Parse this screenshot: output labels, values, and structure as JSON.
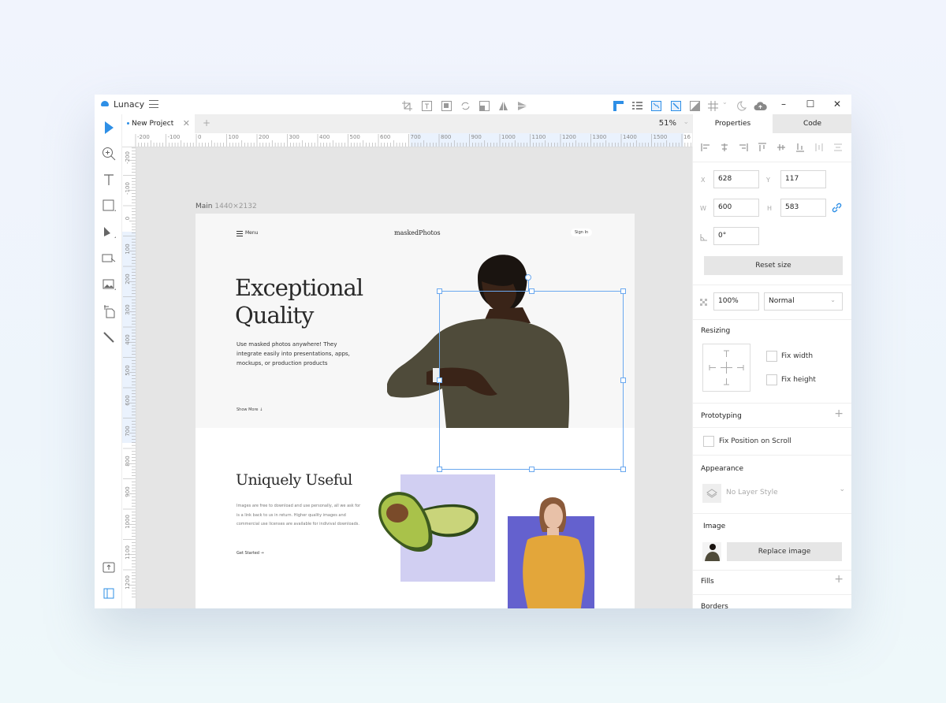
{
  "app": {
    "name": "Lunacy"
  },
  "tabs": [
    {
      "label": "New Project",
      "modified": true
    }
  ],
  "zoom": {
    "level": "51%"
  },
  "rulers": {
    "horizontal": [
      "-200",
      "-100",
      "0",
      "100",
      "200",
      "300",
      "400",
      "500",
      "600",
      "700",
      "800",
      "900",
      "1000",
      "1100",
      "1200",
      "1300",
      "1400",
      "1500",
      "16"
    ],
    "vertical": [
      "-200",
      "-100",
      "0",
      "100",
      "200",
      "300",
      "400",
      "500",
      "600",
      "700",
      "800",
      "900",
      "1000",
      "1100",
      "1200"
    ]
  },
  "artboard": {
    "name": "Main",
    "size": "1440×2132"
  },
  "design": {
    "nav": {
      "menu": "Menu",
      "brand": "maskedPhotos",
      "signin": "Sign In"
    },
    "hero": {
      "title_line1": "Exceptional",
      "title_line2": "Quality",
      "body": "Use masked photos anywhere! They integrate easily into presentations, apps, mockups, or production products",
      "cta": "Show More ↓"
    },
    "section2": {
      "title": "Uniquely Useful",
      "body": "Images are free to download and use personally, all we ask for is a link back to us in return. Higher quality images and commercial use licenses are available for indivival downloads.",
      "cta": "Get Started →"
    },
    "colors": {
      "lavender": "#d1cff2",
      "purple": "#6461ce",
      "selection": "#6aa8ef"
    }
  },
  "panel": {
    "tabs": [
      {
        "label": "Properties",
        "active": true
      },
      {
        "label": "Code",
        "active": false
      }
    ],
    "x": {
      "label": "X",
      "value": "628"
    },
    "y": {
      "label": "Y",
      "value": "117"
    },
    "w": {
      "label": "W",
      "value": "600"
    },
    "h": {
      "label": "H",
      "value": "583"
    },
    "rotation": {
      "value": "0°"
    },
    "reset_size": "Reset size",
    "opacity": "100%",
    "blend_mode": "Normal",
    "resizing": {
      "title": "Resizing",
      "fix_width": "Fix width",
      "fix_height": "Fix height"
    },
    "prototyping": {
      "title": "Prototyping",
      "fix_position": "Fix Position on Scroll"
    },
    "appearance": {
      "title": "Appearance",
      "layer_style": "No Layer Style"
    },
    "image": {
      "title": "Image",
      "replace": "Replace image"
    },
    "fills": {
      "title": "Fills"
    },
    "borders": {
      "title": "Borders"
    }
  },
  "accent": "#2e8fe6"
}
